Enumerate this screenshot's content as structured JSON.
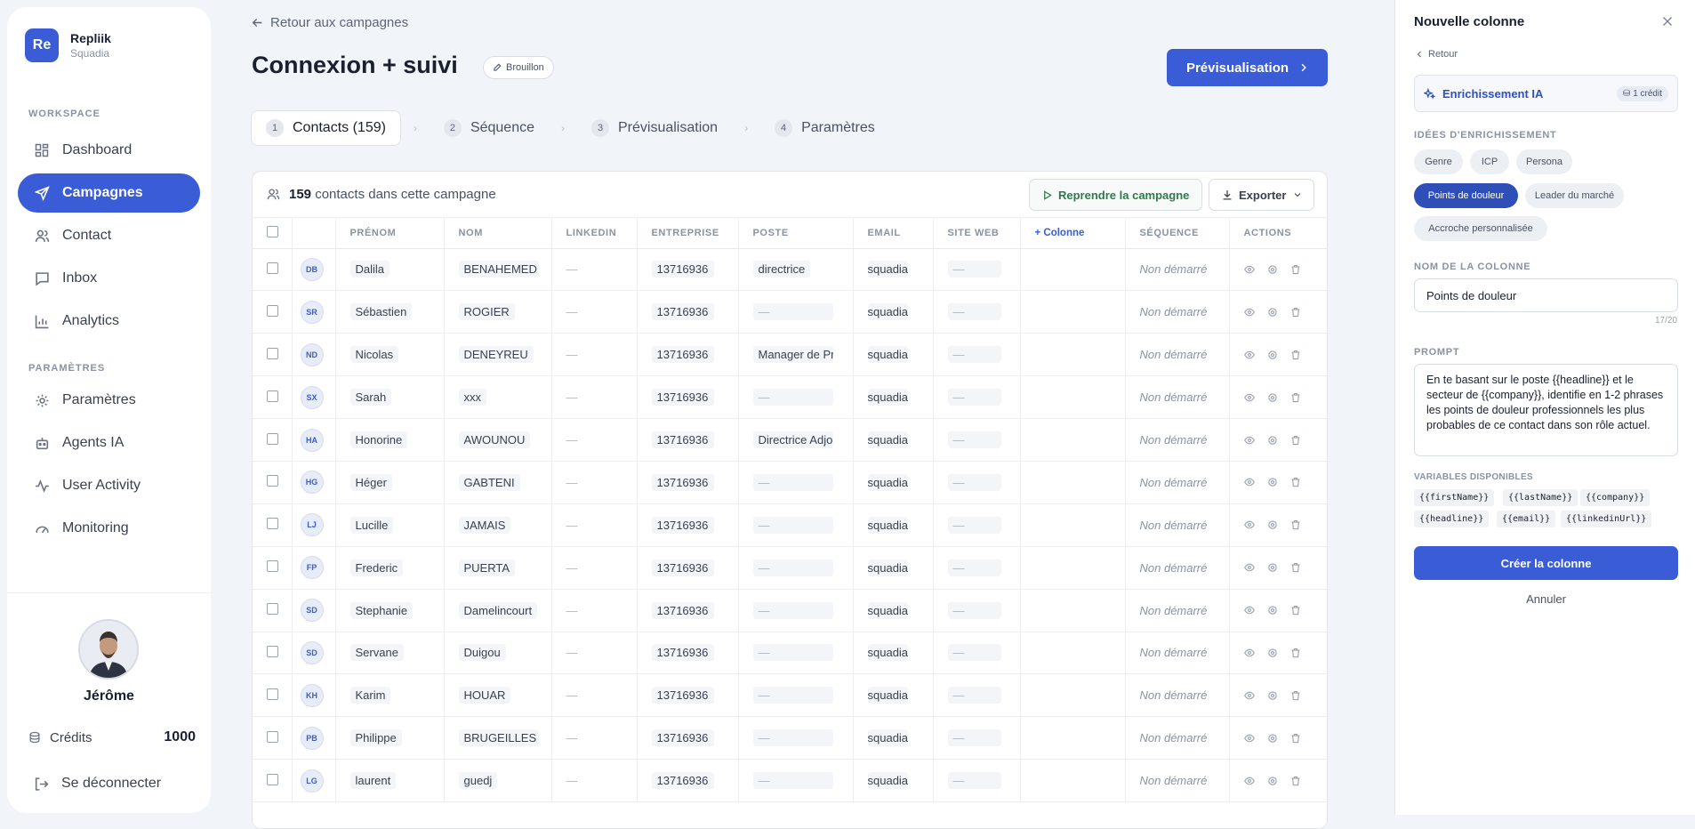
{
  "sidebar": {
    "brand": {
      "logo": "Re",
      "name": "Repliik",
      "workspace": "Squadia"
    },
    "section_workspace": "WORKSPACE",
    "items": [
      {
        "label": "Dashboard",
        "icon": "grid-icon"
      },
      {
        "label": "Campagnes",
        "icon": "send-icon"
      },
      {
        "label": "Contact",
        "icon": "users-icon"
      },
      {
        "label": "Inbox",
        "icon": "message-icon"
      },
      {
        "label": "Analytics",
        "icon": "chart-icon"
      }
    ],
    "section_settings": "PARAMÈTRES",
    "settings_items": [
      {
        "label": "Paramètres",
        "icon": "gear-icon"
      },
      {
        "label": "Agents IA",
        "icon": "robot-icon"
      },
      {
        "label": "User Activity",
        "icon": "activity-icon"
      },
      {
        "label": "Monitoring",
        "icon": "gauge-icon"
      }
    ],
    "user": {
      "name": "Jérôme"
    },
    "credits": {
      "label": "Crédits",
      "value": "1000"
    },
    "logout": "Se déconnecter"
  },
  "header": {
    "back_label": "Retour aux campagnes",
    "title": "Connexion + suivi",
    "status_badge": "Brouillon",
    "preview_button": "Prévisualisation"
  },
  "steps": [
    {
      "num": "1",
      "label": "Contacts (159)"
    },
    {
      "num": "2",
      "label": "Séquence"
    },
    {
      "num": "3",
      "label": "Prévisualisation"
    },
    {
      "num": "4",
      "label": "Paramètres"
    }
  ],
  "table": {
    "count": "159",
    "count_suffix": "contacts dans cette campagne",
    "resume_button": "Reprendre la campagne",
    "export_button": "Exporter",
    "headers": {
      "firstname": "PRÉNOM",
      "lastname": "NOM",
      "linkedin": "LINKEDIN",
      "company": "ENTREPRISE",
      "position": "POSTE",
      "email": "EMAIL",
      "website": "SITE WEB",
      "add_column": "+ Colonne",
      "sequence": "SÉQUENCE",
      "actions": "ACTIONS"
    },
    "rows": [
      {
        "initials": "DB",
        "firstname": "Dalila",
        "lastname": "BENAHEMED",
        "linkedin": "—",
        "company": "13716936",
        "position": "directrice",
        "email": "squadia",
        "website": "—",
        "sequence": "Non démarré"
      },
      {
        "initials": "SR",
        "firstname": "Sébastien",
        "lastname": "ROGIER",
        "linkedin": "—",
        "company": "13716936",
        "position": "—",
        "email": "squadia",
        "website": "—",
        "sequence": "Non démarré"
      },
      {
        "initials": "ND",
        "firstname": "Nicolas",
        "lastname": "DENEYREU",
        "linkedin": "—",
        "company": "13716936",
        "position": "Manager de Pro",
        "email": "squadia",
        "website": "—",
        "sequence": "Non démarré"
      },
      {
        "initials": "SX",
        "firstname": "Sarah",
        "lastname": "xxx",
        "linkedin": "—",
        "company": "13716936",
        "position": "—",
        "email": "squadia",
        "website": "—",
        "sequence": "Non démarré"
      },
      {
        "initials": "HA",
        "firstname": "Honorine",
        "lastname": "AWOUNOU",
        "linkedin": "—",
        "company": "13716936",
        "position": "Directrice Adjoi",
        "email": "squadia",
        "website": "—",
        "sequence": "Non démarré"
      },
      {
        "initials": "HG",
        "firstname": "Héger",
        "lastname": "GABTENI",
        "linkedin": "—",
        "company": "13716936",
        "position": "—",
        "email": "squadia",
        "website": "—",
        "sequence": "Non démarré"
      },
      {
        "initials": "LJ",
        "firstname": "Lucille",
        "lastname": "JAMAIS",
        "linkedin": "—",
        "company": "13716936",
        "position": "—",
        "email": "squadia",
        "website": "—",
        "sequence": "Non démarré"
      },
      {
        "initials": "FP",
        "firstname": "Frederic",
        "lastname": "PUERTA",
        "linkedin": "—",
        "company": "13716936",
        "position": "—",
        "email": "squadia",
        "website": "—",
        "sequence": "Non démarré"
      },
      {
        "initials": "SD",
        "firstname": "Stephanie",
        "lastname": "Damelincourt",
        "linkedin": "—",
        "company": "13716936",
        "position": "—",
        "email": "squadia",
        "website": "—",
        "sequence": "Non démarré"
      },
      {
        "initials": "SD",
        "firstname": "Servane",
        "lastname": "Duigou",
        "linkedin": "—",
        "company": "13716936",
        "position": "—",
        "email": "squadia",
        "website": "—",
        "sequence": "Non démarré"
      },
      {
        "initials": "KH",
        "firstname": "Karim",
        "lastname": "HOUAR",
        "linkedin": "—",
        "company": "13716936",
        "position": "—",
        "email": "squadia",
        "website": "—",
        "sequence": "Non démarré"
      },
      {
        "initials": "PB",
        "firstname": "Philippe",
        "lastname": "BRUGEILLES",
        "linkedin": "—",
        "company": "13716936",
        "position": "—",
        "email": "squadia",
        "website": "—",
        "sequence": "Non démarré"
      },
      {
        "initials": "LG",
        "firstname": "laurent",
        "lastname": "guedj",
        "linkedin": "—",
        "company": "13716936",
        "position": "—",
        "email": "squadia",
        "website": "—",
        "sequence": "Non démarré"
      }
    ]
  },
  "panel": {
    "title": "Nouvelle colonne",
    "back": "Retour",
    "enrichment": {
      "label": "Enrichissement IA",
      "credit": "1 crédit"
    },
    "ideas_label": "IDÉES D'ENRICHISSEMENT",
    "ideas": [
      "Genre",
      "ICP",
      "Persona",
      "Points de douleur",
      "Leader du marché",
      "Accroche personnalisée"
    ],
    "selected_idea": "Points de douleur",
    "name_label": "NOM DE LA COLONNE",
    "name_value": "Points de douleur",
    "name_counter": "17/20",
    "prompt_label": "PROMPT",
    "prompt_value": "En te basant sur le poste {{headline}} et le secteur de {{company}}, identifie en 1-2 phrases les points de douleur professionnels les plus probables de ce contact dans son rôle actuel.",
    "vars_label": "VARIABLES DISPONIBLES",
    "variables": [
      "{{firstName}}",
      "{{lastName}}",
      "{{company}}",
      "{{headline}}",
      "{{email}}",
      "{{linkedinUrl}}"
    ],
    "create_button": "Créer la colonne",
    "cancel_button": "Annuler"
  },
  "colors": {
    "accent": "#3a5cd6",
    "selected_chip": "#2f4fb8",
    "resume_green": "#2f7a4c"
  }
}
